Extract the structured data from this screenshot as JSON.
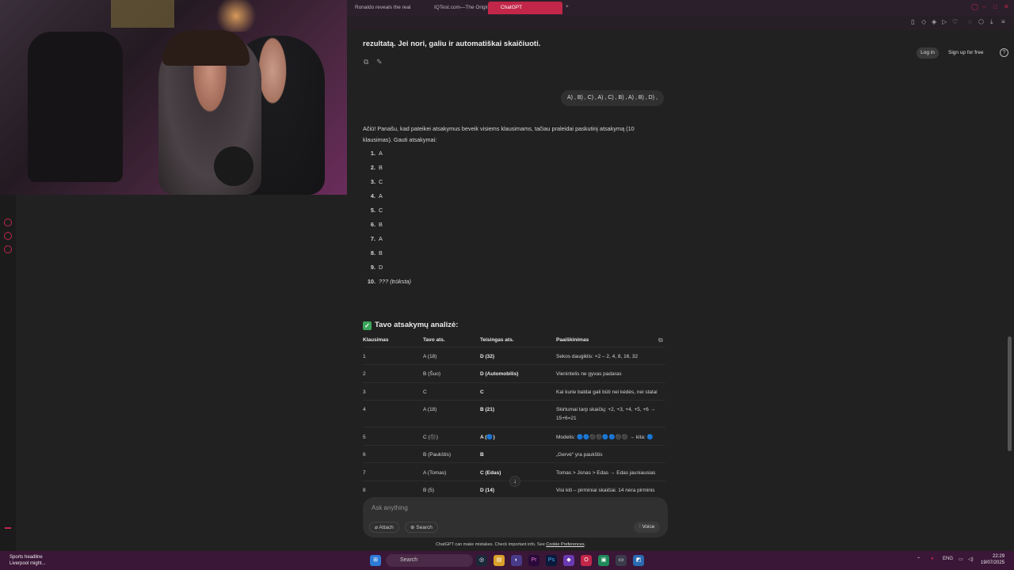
{
  "browser": {
    "tabs": [
      {
        "label": "Ronaldo reveals the real t"
      },
      {
        "label": "IQTest.com—The Original"
      },
      {
        "label": "ChatGPT"
      }
    ],
    "new_tab_label": "+"
  },
  "header": {
    "login_label": "Log in",
    "signup_label": "Sign up for free",
    "help_label": "?"
  },
  "conversation": {
    "prev_message_tail": "rezultatą. Jei nori, galiu ir automatiškai skaičiuoti.",
    "user_message": "A) , B) , C) , A) , C) , B) , A) , B) , D) ,",
    "reply_intro": "Ačiū! Panašu, kad pateikei atsakymus beveik visiems klausimams, tačiau praleidai paskutinį atsakymą (10 klausimas). Gauti atsakymai:",
    "answers": [
      {
        "num": "1.",
        "value": "A"
      },
      {
        "num": "2.",
        "value": "B"
      },
      {
        "num": "3.",
        "value": "C"
      },
      {
        "num": "4.",
        "value": "A"
      },
      {
        "num": "5.",
        "value": "C"
      },
      {
        "num": "6.",
        "value": "B"
      },
      {
        "num": "7.",
        "value": "A"
      },
      {
        "num": "8.",
        "value": "B"
      },
      {
        "num": "9.",
        "value": "D"
      },
      {
        "num": "10.",
        "value": "??? (trūksta)"
      }
    ],
    "analysis_title": "Tavo atsakymų analizė:",
    "table": {
      "headers": [
        "Klausimas",
        "Tavo ats.",
        "Teisingas ats.",
        "Paaiškinimas"
      ],
      "rows": [
        {
          "q": "1",
          "yours": "A (18)",
          "correct": "D (32)",
          "expl": "Sekos daugiklis: ×2 – 2, 4, 8, 16, 32"
        },
        {
          "q": "2",
          "yours": "B (Šuo)",
          "correct": "D (Automobilis)",
          "expl": "Vienintelis ne gyvas padaras"
        },
        {
          "q": "3",
          "yours": "C",
          "correct": "C",
          "expl": "Kai kurie baldai gali būti nei kėdės, nei stalai"
        },
        {
          "q": "4",
          "yours": "A (18)",
          "correct": "B (21)",
          "expl": "Skirtumai tarp skaičių: +2, +3, +4, +5, +6 → 15+6=21"
        },
        {
          "q": "5",
          "yours": "C (⚫)",
          "correct": "A (🔵)",
          "expl": "Modelis: 🔵🔵⚫⚫🔵🔵⚫⚫ → kita: 🔵"
        },
        {
          "q": "6",
          "yours": "B (Paukštis)",
          "correct": "B",
          "expl": "„Gervė“ yra paukštis"
        },
        {
          "q": "7",
          "yours": "A (Tomas)",
          "correct": "C (Edas)",
          "expl": "Tomas > Jonas > Edas → Edas jauniausias"
        },
        {
          "q": "8",
          "yours": "B (5)",
          "correct": "D (14)",
          "expl": "Visi kiti – pirminiai skaičiai. 14 nėra pirminis"
        }
      ]
    }
  },
  "composer": {
    "placeholder": "Ask anything",
    "attach_label": "Attach",
    "search_label": "Search",
    "voice_label": "Voice",
    "disclaimer": "ChatGPT can make mistakes. Check important info. See",
    "disclaimer_link": "Cookie Preferences",
    "disclaimer_end": "."
  },
  "taskbar": {
    "news_title": "Sports headline",
    "news_sub": "Liverpool might...",
    "search_label": "Search",
    "lang": "ENG",
    "time": "22:29",
    "date": "19/07/2025"
  },
  "colors": {
    "accent": "#c2274a",
    "background": "#212121",
    "taskbar": "#3a1637",
    "check_green": "#3aa55a"
  }
}
